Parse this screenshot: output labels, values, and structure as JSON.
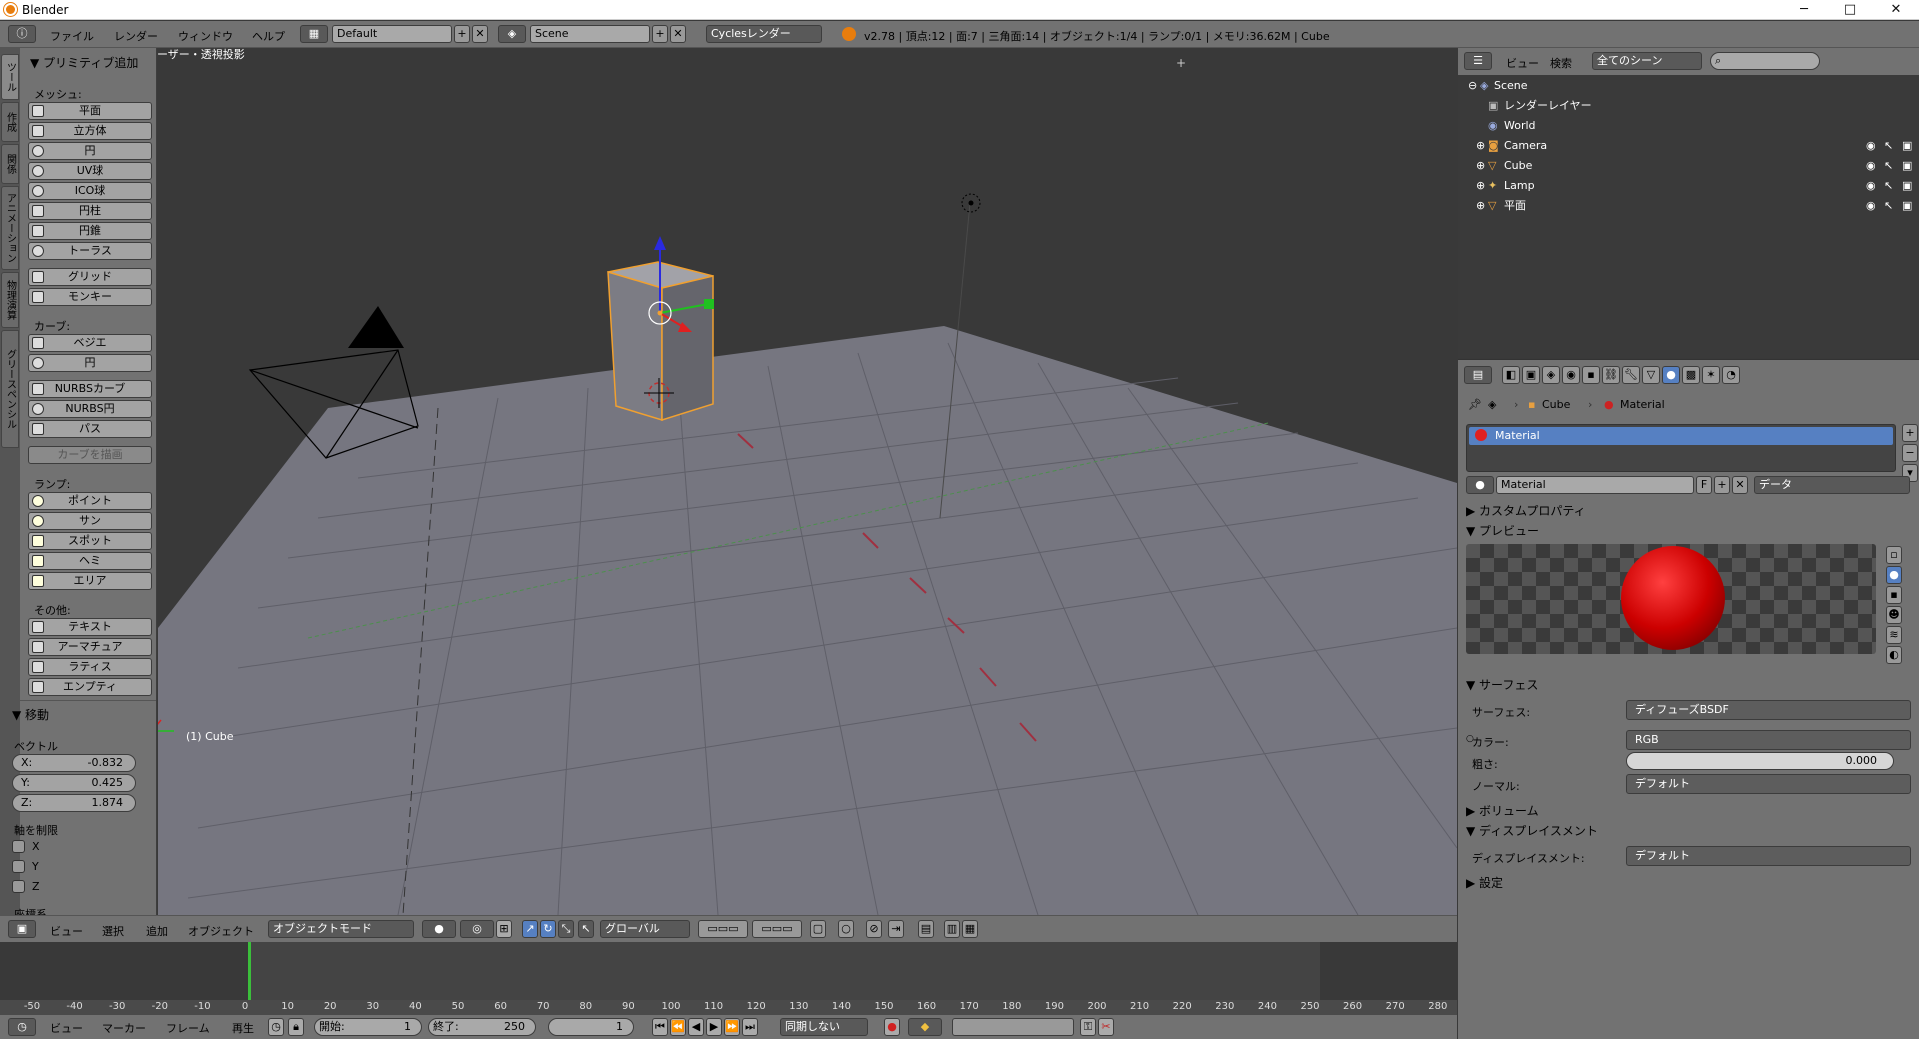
{
  "window": {
    "title": "Blender",
    "min": "─",
    "max": "□",
    "close": "✕"
  },
  "infobar": {
    "menus": [
      "ファイル",
      "レンダー",
      "ウィンドウ",
      "ヘルプ"
    ],
    "layout": "Default",
    "scene": "Scene",
    "engine": "Cyclesレンダー",
    "stats": "v2.78 | 頂点:12 | 面:7 | 三角面:14 | オブジェクト:1/4 | ランプ:0/1 | メモリ:36.62M | Cube"
  },
  "toolshelf": {
    "tabs": [
      "ツール",
      "作成",
      "関係",
      "アニメーション",
      "物理演算",
      "グリースペンシル"
    ],
    "header": "▼ プリミティブ追加",
    "mesh_label": "メッシュ:",
    "mesh": [
      "平面",
      "立方体",
      "円",
      "UV球",
      "ICO球",
      "円柱",
      "円錐",
      "トーラス"
    ],
    "mesh2": [
      "グリッド",
      "モンキー"
    ],
    "curve_label": "カーブ:",
    "curve": [
      "ベジエ",
      "円"
    ],
    "curve2": [
      "NURBSカーブ",
      "NURBS円",
      "パス"
    ],
    "draw_curve": "カーブを描画",
    "lamp_label": "ランプ:",
    "lamps": [
      "ポイント",
      "サン",
      "スポット",
      "ヘミ",
      "エリア"
    ],
    "other_label": "その他:",
    "other": [
      "テキスト",
      "アーマチュア",
      "ラティス",
      "エンプティ"
    ]
  },
  "operator": {
    "title": "▼ 移動",
    "vector_label": "ベクトル",
    "x_label": "X:",
    "x": "-0.832",
    "y_label": "Y:",
    "y": "0.425",
    "z_label": "Z:",
    "z": "1.874",
    "constraint_label": "軸を制限",
    "axes": [
      "X",
      "Y",
      "Z"
    ],
    "coord_label": "座標系"
  },
  "viewport": {
    "label": "ユーザー・透視投影",
    "object": "(1) Cube"
  },
  "view3d_header": {
    "menus": [
      "ビュー",
      "選択",
      "追加",
      "オブジェクト"
    ],
    "mode": "オブジェクトモード",
    "orientation": "グローバル"
  },
  "timeline": {
    "ticks": [
      "-50",
      "-40",
      "-30",
      "-20",
      "-10",
      "0",
      "10",
      "20",
      "30",
      "40",
      "50",
      "60",
      "70",
      "80",
      "90",
      "100",
      "110",
      "120",
      "130",
      "140",
      "150",
      "160",
      "170",
      "180",
      "190",
      "200",
      "210",
      "220",
      "230",
      "240",
      "250",
      "260",
      "270",
      "280"
    ],
    "menus": [
      "ビュー",
      "マーカー",
      "フレーム",
      "再生"
    ],
    "start_label": "開始:",
    "start": "1",
    "end_label": "終了:",
    "end": "250",
    "current": "1",
    "sync": "同期しない"
  },
  "outliner": {
    "menus": [
      "ビュー",
      "検索"
    ],
    "filter": "全てのシーン",
    "items": [
      "Scene",
      "レンダーレイヤー",
      "World",
      "Camera",
      "Cube",
      "Lamp",
      "平面"
    ]
  },
  "properties": {
    "breadcrumb_obj": "Cube",
    "breadcrumb_mat": "Material",
    "slot": "Material",
    "material_name": "Material",
    "fake_user": "F",
    "link": "データ",
    "sections": {
      "custom": "▶ カスタムプロパティ",
      "preview": "▼ プレビュー",
      "surface": "▼ サーフェス",
      "volume": "▶ ボリューム",
      "displacement": "▼ ディスプレイスメント",
      "settings": "▶ 設定"
    },
    "surface_label": "サーフェス:",
    "surface_value": "ディフューズBSDF",
    "color_label": "カラー:",
    "color_value": "RGB",
    "rough_label": "粗さ:",
    "rough_value": "0.000",
    "normal_label": "ノーマル:",
    "normal_value": "デフォルト",
    "disp_label": "ディスプレイスメント:",
    "disp_value": "デフォルト"
  }
}
